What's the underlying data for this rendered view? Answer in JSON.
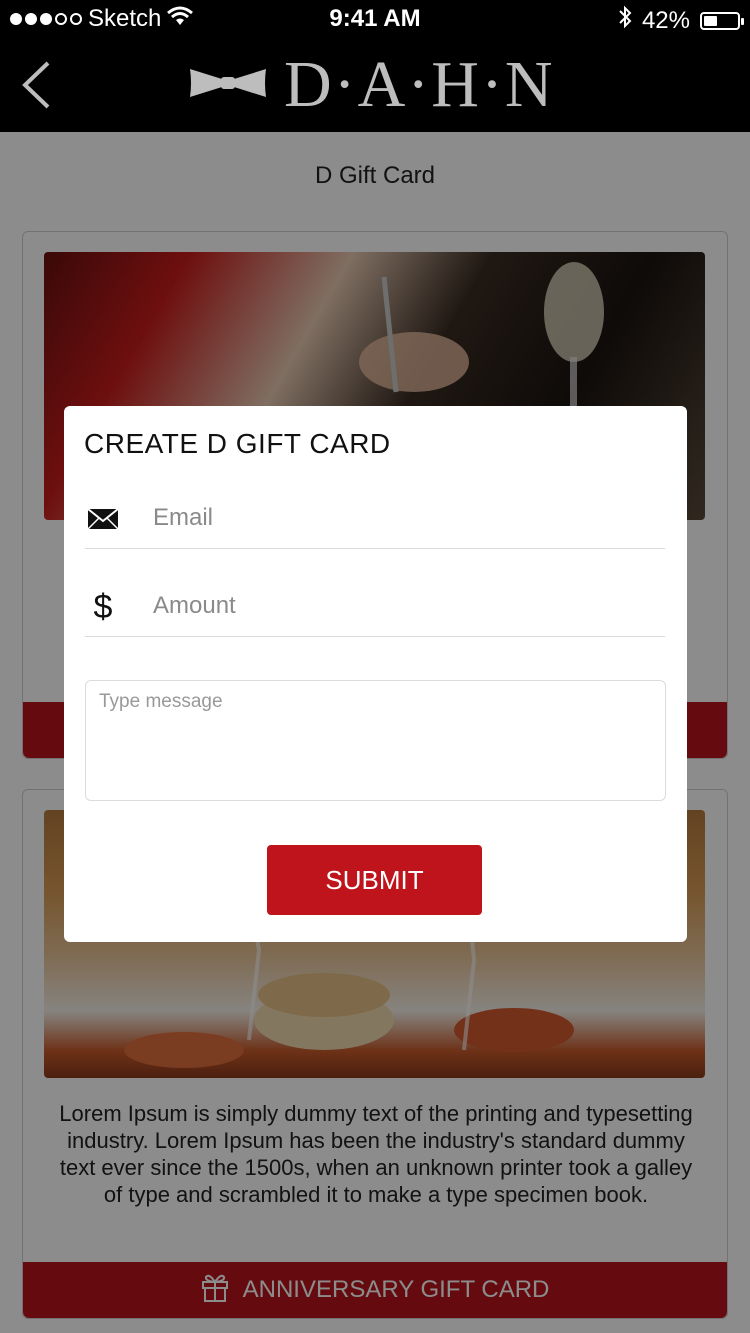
{
  "status_bar": {
    "carrier": "Sketch",
    "time": "9:41 AM",
    "battery_percent": "42%",
    "battery_level": 0.42,
    "icons": [
      "signal-dots-icon",
      "wifi-icon",
      "bluetooth-icon",
      "battery-icon"
    ]
  },
  "nav": {
    "logo_text": "D·A·H·N",
    "back_icon": "chevron-left-icon",
    "logo_icon": "bow-tie-icon"
  },
  "page": {
    "title": "D Gift Card"
  },
  "cards": [
    {
      "image": "restaurant dining photo",
      "description": "",
      "button_label": ""
    },
    {
      "image": "table with dim sum and wine glasses photo",
      "description": "Lorem Ipsum is simply dummy text of the printing and typesetting industry. Lorem Ipsum has been the industry's standard dummy text ever since the 1500s, when an unknown printer took a galley of type and scrambled it to make a type specimen book.",
      "button_label": "ANNIVERSARY GIFT CARD",
      "button_icon": "gift-icon"
    }
  ],
  "modal": {
    "title": "CREATE D GIFT CARD",
    "email_placeholder": "Email",
    "email_icon": "envelope-icon",
    "amount_placeholder": "Amount",
    "amount_icon": "$",
    "message_placeholder": "Type message",
    "submit_label": "SUBMIT"
  },
  "colors": {
    "accent_red": "#c0141c",
    "header_black": "#000000",
    "logo_gray": "#bdbdbd"
  }
}
